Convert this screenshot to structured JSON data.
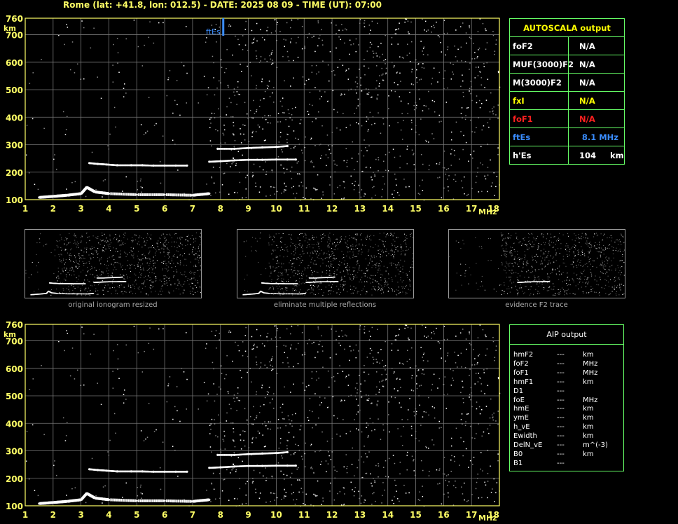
{
  "header": {
    "title": "Rome (lat: +41.8, lon: 012.5) - DATE: 2025 08 09 - TIME (UT): 07:00"
  },
  "autoscala": {
    "title": "AUTOSCALA output",
    "rows": [
      {
        "label": "foF2",
        "value": "N/A",
        "color": "#ffffff"
      },
      {
        "label": "MUF(3000)F2",
        "value": "N/A",
        "color": "#ffffff"
      },
      {
        "label": "M(3000)F2",
        "value": "N/A",
        "color": "#ffffff"
      },
      {
        "label": "fxI",
        "value": "N/A",
        "color": "#ffff00"
      },
      {
        "label": "foF1",
        "value": "N/A",
        "color": "#ff2020"
      },
      {
        "label": "ftEs",
        "value": "8.1 MHz",
        "color": "#3a8dff"
      },
      {
        "label": "h'Es",
        "value": "104     km",
        "color": "#ffffff"
      }
    ]
  },
  "aip": {
    "title": "AIP output",
    "rows": [
      {
        "label": "hmF2",
        "value": "---",
        "unit": "km"
      },
      {
        "label": "foF2",
        "value": "---",
        "unit": "MHz"
      },
      {
        "label": "foF1",
        "value": "---",
        "unit": "MHz"
      },
      {
        "label": "hmF1",
        "value": "---",
        "unit": "km"
      },
      {
        "label": "D1",
        "value": "---",
        "unit": ""
      },
      {
        "label": "foE",
        "value": "---",
        "unit": "MHz"
      },
      {
        "label": "hmE",
        "value": "---",
        "unit": "km"
      },
      {
        "label": "ymE",
        "value": "---",
        "unit": "km"
      },
      {
        "label": "h_vE",
        "value": "---",
        "unit": "km"
      },
      {
        "label": "Ewidth",
        "value": "---",
        "unit": "km"
      },
      {
        "label": "DelN_vE",
        "value": "---",
        "unit": "m^(-3)"
      },
      {
        "label": "B0",
        "value": "---",
        "unit": "km"
      },
      {
        "label": "B1",
        "value": "---",
        "unit": ""
      }
    ]
  },
  "thumbnails": [
    {
      "caption": "original ionogram resized"
    },
    {
      "caption": "eliminate multiple reflections"
    },
    {
      "caption": "evidence F2 trace"
    }
  ],
  "chart_data": [
    {
      "type": "scatter",
      "title": "",
      "xlabel": "MHz",
      "ylabel": "km",
      "xlim": [
        1,
        18
      ],
      "ylim": [
        100,
        760
      ],
      "x_ticks": [
        1,
        2,
        3,
        4,
        5,
        6,
        7,
        8,
        9,
        10,
        11,
        12,
        13,
        14,
        15,
        16,
        17,
        18
      ],
      "y_ticks": [
        100,
        200,
        300,
        400,
        500,
        600,
        700,
        760
      ],
      "grid": true,
      "annotation": {
        "text": "ftEs",
        "x": 8.1,
        "color": "#3a8dff"
      },
      "traces": [
        {
          "name": "",
          "x": [
            1.5,
            2.0,
            2.5,
            3.0,
            3.2,
            3.5,
            4.0,
            5.0,
            6.0,
            7.0,
            7.6
          ],
          "y": [
            108,
            112,
            116,
            122,
            145,
            128,
            122,
            118,
            118,
            116,
            122
          ]
        },
        {
          "name": "",
          "x": [
            3.3,
            3.6,
            3.9,
            4.3,
            4.8,
            5.2,
            5.6,
            6.0,
            6.4,
            6.8
          ],
          "y": [
            233,
            230,
            228,
            225,
            225,
            225,
            224,
            224,
            224,
            224
          ]
        },
        {
          "name": "",
          "x": [
            7.6,
            8.0,
            8.5,
            9.0,
            9.5,
            10.0,
            10.4,
            10.7
          ],
          "y": [
            238,
            240,
            243,
            245,
            245,
            246,
            246,
            246
          ]
        },
        {
          "name": "",
          "x": [
            7.9,
            8.5,
            9.0,
            9.5,
            10.0,
            10.4
          ],
          "y": [
            285,
            285,
            288,
            290,
            292,
            295
          ]
        }
      ]
    },
    {
      "type": "scatter",
      "title": "",
      "xlabel": "MHz",
      "ylabel": "km",
      "xlim": [
        1,
        18
      ],
      "ylim": [
        100,
        760
      ],
      "x_ticks": [
        1,
        2,
        3,
        4,
        5,
        6,
        7,
        8,
        9,
        10,
        11,
        12,
        13,
        14,
        15,
        16,
        17,
        18
      ],
      "y_ticks": [
        100,
        200,
        300,
        400,
        500,
        600,
        700,
        760
      ],
      "grid": true,
      "traces": [
        {
          "name": "",
          "x": [
            1.5,
            2.0,
            2.5,
            3.0,
            3.2,
            3.5,
            4.0,
            5.0,
            6.0,
            7.0,
            7.6
          ],
          "y": [
            108,
            112,
            116,
            122,
            145,
            128,
            122,
            118,
            118,
            116,
            122
          ]
        },
        {
          "name": "",
          "x": [
            3.3,
            3.6,
            3.9,
            4.3,
            4.8,
            5.2,
            5.6,
            6.0,
            6.4,
            6.8
          ],
          "y": [
            233,
            230,
            228,
            225,
            225,
            225,
            224,
            224,
            224,
            224
          ]
        },
        {
          "name": "",
          "x": [
            7.6,
            8.0,
            8.5,
            9.0,
            9.5,
            10.0,
            10.4,
            10.7
          ],
          "y": [
            238,
            240,
            243,
            245,
            245,
            246,
            246,
            246
          ]
        },
        {
          "name": "",
          "x": [
            7.9,
            8.5,
            9.0,
            9.5,
            10.0,
            10.4
          ],
          "y": [
            285,
            285,
            288,
            290,
            292,
            295
          ]
        }
      ]
    }
  ]
}
